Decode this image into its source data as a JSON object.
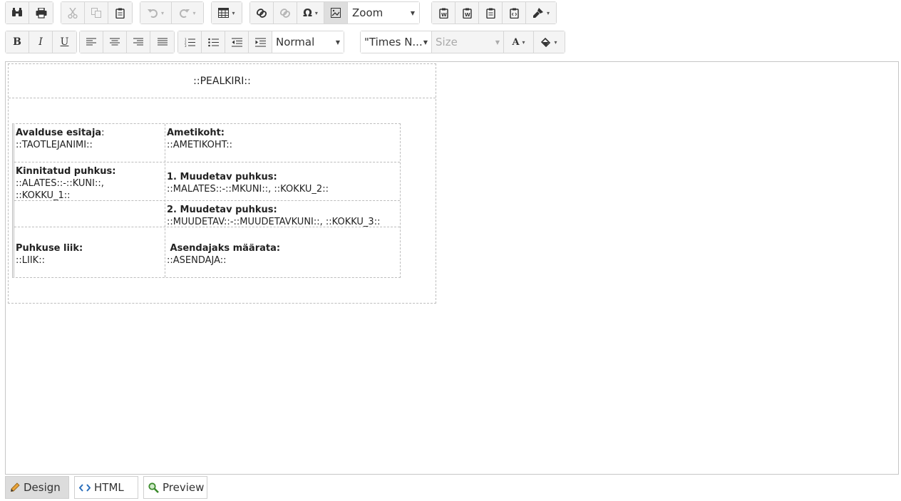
{
  "toolbar": {
    "zoom_label": "Zoom",
    "paragraph_format": "Normal",
    "font_name": "\"Times N...",
    "font_size_placeholder": "Size"
  },
  "document": {
    "title": "::PEALKIRI::",
    "rows": [
      {
        "left_label": "Avalduse esitaja",
        "left_colon": ":",
        "left_value": "::TAOTLEJANIMI::",
        "right_label": "Ametikoht:",
        "right_value": "::AMETIKOHT::"
      },
      {
        "left_label": "Kinnitatud puhkus:",
        "left_value_1": "::ALATES::-::KUNI::,",
        "left_value_2": "::KOKKU_1::",
        "right_label": "1. Muudetav puhkus:",
        "right_value": "::MALATES::-::MKUNI::, ::KOKKU_2::"
      },
      {
        "right_label": "2. Muudetav puhkus:",
        "right_value": "::MUUDETAV::-::MUUDETAVKUNI::, ::KOKKU_3::"
      },
      {
        "left_label": "Puhkuse liik:",
        "left_value": "::LIIK::",
        "right_label": " Asendajaks määrata:",
        "right_value": "::ASENDAJA::"
      }
    ]
  },
  "tabs": [
    {
      "label": "Design",
      "icon": "pencil-icon",
      "active": true
    },
    {
      "label": "HTML",
      "icon": "code-icon",
      "active": false
    },
    {
      "label": "Preview",
      "icon": "magnifier-icon",
      "active": false
    }
  ]
}
